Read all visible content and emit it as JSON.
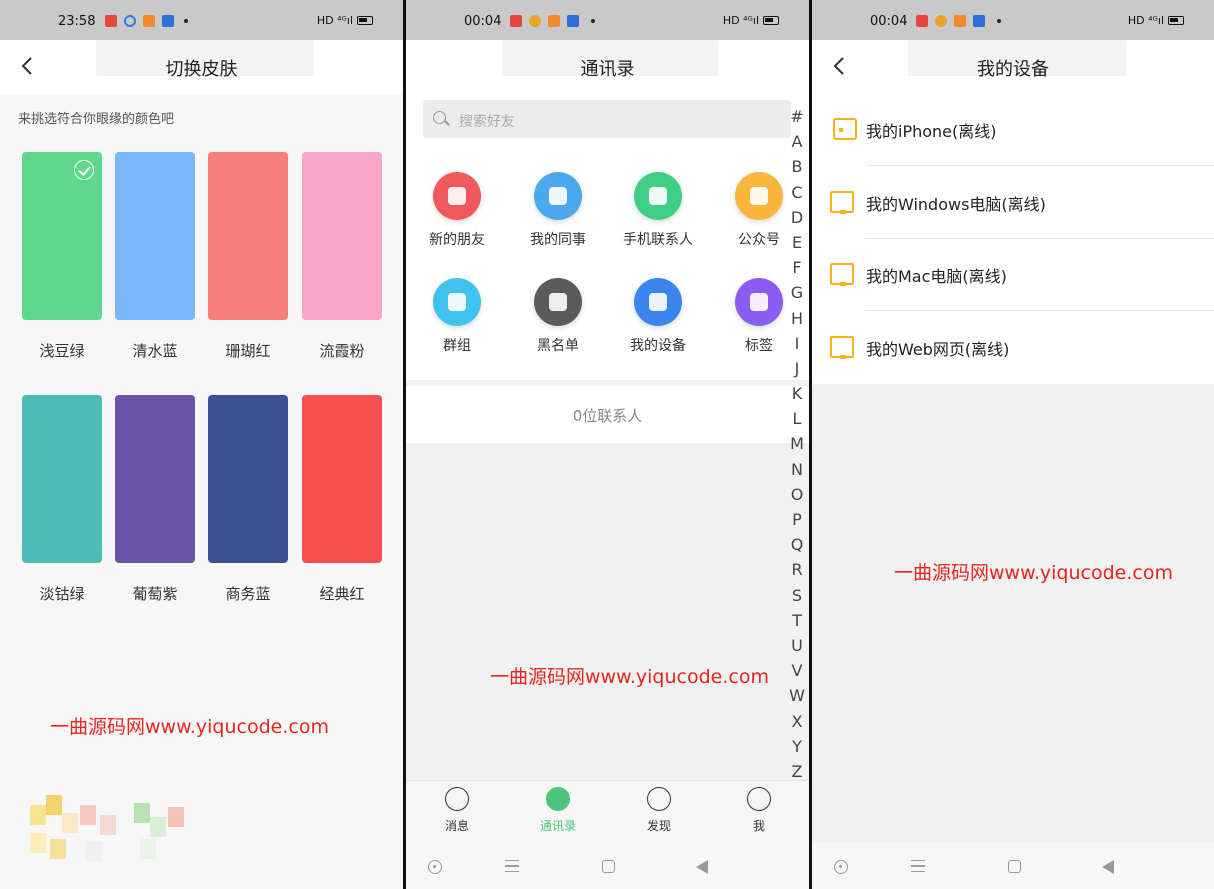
{
  "panel1": {
    "status_time": "23:58",
    "status_right": "HD",
    "title": "切换皮肤",
    "hint": "来挑选符合你眼缘的颜色吧",
    "skins": [
      {
        "label": "浅豆绿",
        "color": "#5fd88f",
        "selected": true
      },
      {
        "label": "清水蓝",
        "color": "#79b8f8",
        "selected": false
      },
      {
        "label": "珊瑚红",
        "color": "#f77b7b",
        "selected": false
      },
      {
        "label": "流霞粉",
        "color": "#f9a5c9",
        "selected": false
      },
      {
        "label": "淡钴绿",
        "color": "#4cbcb4",
        "selected": false
      },
      {
        "label": "葡萄紫",
        "color": "#6b54a8",
        "selected": false
      },
      {
        "label": "商务蓝",
        "color": "#3a5194",
        "selected": false
      },
      {
        "label": "经典红",
        "color": "#f74f4f",
        "selected": false
      }
    ],
    "watermark": "一曲源码网www.yiqucode.com"
  },
  "panel2": {
    "status_time": "00:04",
    "status_right": "HD",
    "title": "通讯录",
    "search_placeholder": "搜索好友",
    "entries": [
      {
        "label": "新的朋友",
        "color": "#f15a5a",
        "icon": "new-friend-icon"
      },
      {
        "label": "我的同事",
        "color": "#4aa8ec",
        "icon": "colleague-icon"
      },
      {
        "label": "手机联系人",
        "color": "#3fcf84",
        "icon": "phone-contacts-icon"
      },
      {
        "label": "公众号",
        "color": "#f8b63c",
        "icon": "official-account-icon"
      },
      {
        "label": "群组",
        "color": "#3fc2ec",
        "icon": "group-icon"
      },
      {
        "label": "黑名单",
        "color": "#5b5b5b",
        "icon": "blacklist-icon"
      },
      {
        "label": "我的设备",
        "color": "#3a86ec",
        "icon": "my-device-icon"
      },
      {
        "label": "标签",
        "color": "#8a5cf0",
        "icon": "tag-icon"
      }
    ],
    "contact_count": "0位联系人",
    "alphabet": [
      "#",
      "A",
      "B",
      "C",
      "D",
      "E",
      "F",
      "G",
      "H",
      "I",
      "J",
      "K",
      "L",
      "M",
      "N",
      "O",
      "P",
      "Q",
      "R",
      "S",
      "T",
      "U",
      "V",
      "W",
      "X",
      "Y",
      "Z"
    ],
    "tabs": [
      {
        "label": "消息",
        "icon": "message-icon",
        "active": false
      },
      {
        "label": "通讯录",
        "icon": "contacts-icon",
        "active": true
      },
      {
        "label": "发现",
        "icon": "discover-icon",
        "active": false
      },
      {
        "label": "我",
        "icon": "me-icon",
        "active": false
      }
    ],
    "watermark": "一曲源码网www.yiqucode.com"
  },
  "panel3": {
    "status_time": "00:04",
    "status_right": "HD",
    "title": "我的设备",
    "devices": [
      {
        "label": "我的iPhone(离线)",
        "icon": "phone-device-icon"
      },
      {
        "label": "我的Windows电脑(离线)",
        "icon": "monitor-icon"
      },
      {
        "label": "我的Mac电脑(离线)",
        "icon": "monitor-icon"
      },
      {
        "label": "我的Web网页(离线)",
        "icon": "web-monitor-icon"
      }
    ],
    "watermark": "一曲源码网www.yiqucode.com"
  },
  "accent_green": "#4cc47a",
  "device_icon_color": "#f2b21b",
  "watermark_color": "#e8251f"
}
